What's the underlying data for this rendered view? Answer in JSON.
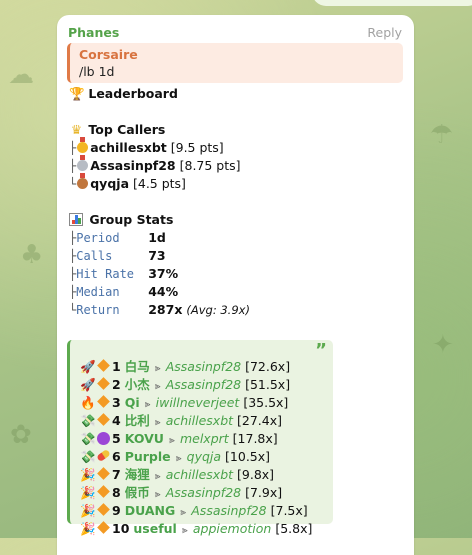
{
  "message": {
    "sender": "Phanes",
    "reply_label": "Reply",
    "quote": {
      "author": "Corsaire",
      "text": "/lb 1d"
    },
    "leaderboard_title": "Leaderboard",
    "top_callers_title": "Top Callers",
    "top_callers": [
      {
        "tree": "├",
        "medal": "gold",
        "name": "achillesxbt",
        "pts": "[9.5 pts]"
      },
      {
        "tree": "├",
        "medal": "silver",
        "name": "Assasinpf28",
        "pts": "[8.75 pts]"
      },
      {
        "tree": "└",
        "medal": "bronze",
        "name": "qyqja",
        "pts": "[4.5 pts]"
      }
    ],
    "group_stats_title": "Group Stats",
    "stats": [
      {
        "tree": "├",
        "key": "Period",
        "value": "1d",
        "extra": ""
      },
      {
        "tree": "├",
        "key": "Calls",
        "value": "73",
        "extra": ""
      },
      {
        "tree": "├",
        "key": "Hit Rate",
        "value": "37%",
        "extra": ""
      },
      {
        "tree": "├",
        "key": "Median",
        "value": "44%",
        "extra": ""
      },
      {
        "tree": "└",
        "key": "Return",
        "value": "287x",
        "extra": "(Avg: 3.9x)"
      }
    ],
    "quote_mark": "”",
    "rankings": [
      {
        "emoji": "rocket",
        "badge": "diamond",
        "rank": "1",
        "token": "白马",
        "caller": "Assasinpf28",
        "mult": "[72.6x]"
      },
      {
        "emoji": "rocket",
        "badge": "diamond",
        "rank": "2",
        "token": "小杰",
        "caller": "Assasinpf28",
        "mult": "[51.5x]"
      },
      {
        "emoji": "fire",
        "badge": "diamond",
        "rank": "3",
        "token": "Qi",
        "caller": "iwillneverjeet",
        "mult": "[35.5x]"
      },
      {
        "emoji": "money",
        "badge": "diamond",
        "rank": "4",
        "token": "比利",
        "caller": "achillesxbt",
        "mult": "[27.4x]"
      },
      {
        "emoji": "money",
        "badge": "purple",
        "rank": "5",
        "token": "KOVU",
        "caller": "melxprt",
        "mult": "[17.8x]"
      },
      {
        "emoji": "money",
        "badge": "pill",
        "rank": "6",
        "token": "Purple",
        "caller": "qyqja",
        "mult": "[10.5x]"
      },
      {
        "emoji": "party",
        "badge": "diamond",
        "rank": "7",
        "token": "海狸",
        "caller": "achillesxbt",
        "mult": "[9.8x]"
      },
      {
        "emoji": "party",
        "badge": "diamond",
        "rank": "8",
        "token": "假币",
        "caller": "Assasinpf28",
        "mult": "[7.9x]"
      },
      {
        "emoji": "party",
        "badge": "diamond",
        "rank": "9",
        "token": "DUANG",
        "caller": "Assasinpf28",
        "mult": "[7.5x]"
      },
      {
        "emoji": "party",
        "badge": "diamond",
        "rank": "10",
        "token": "useful",
        "caller": "appiemotion",
        "mult": "[5.8x]"
      }
    ]
  },
  "colors": {
    "sender": "#55a34a",
    "quote_accent": "#e07a47",
    "link_green": "#4aa24b",
    "mono_blue": "#4a72a8",
    "background": "#a9c488"
  }
}
